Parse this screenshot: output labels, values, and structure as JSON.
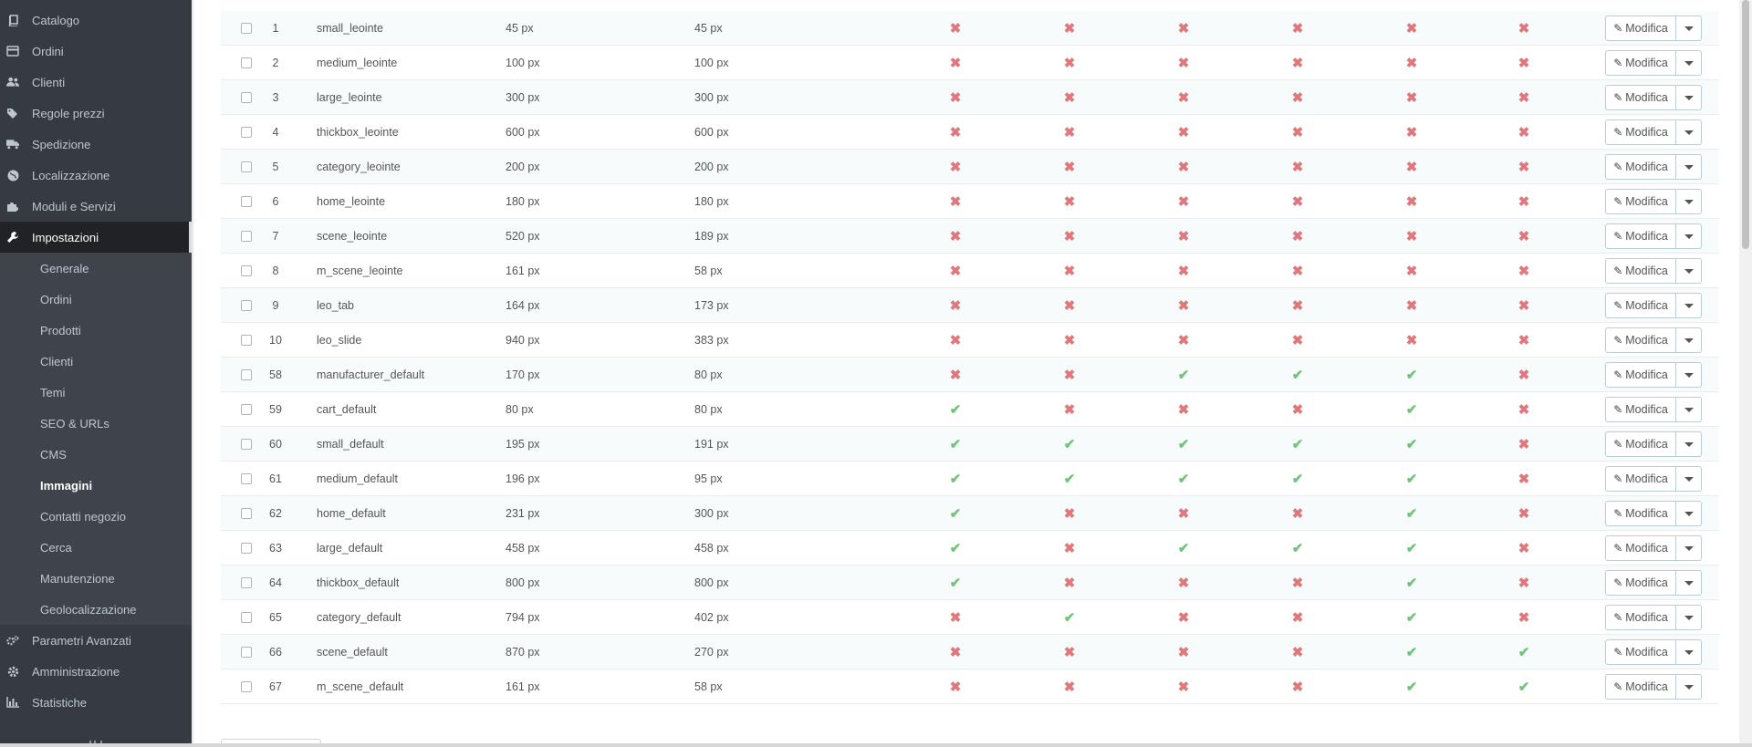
{
  "sidebar": {
    "items": [
      {
        "label": "Catalogo",
        "icon": "book-icon"
      },
      {
        "label": "Ordini",
        "icon": "credit-card-icon"
      },
      {
        "label": "Clienti",
        "icon": "users-icon"
      },
      {
        "label": "Regole prezzi",
        "icon": "tags-icon"
      },
      {
        "label": "Spedizione",
        "icon": "truck-icon"
      },
      {
        "label": "Localizzazione",
        "icon": "globe-icon"
      },
      {
        "label": "Moduli e Servizi",
        "icon": "puzzle-icon"
      },
      {
        "label": "Impostazioni",
        "icon": "wrench-icon"
      },
      {
        "label": "Parametri Avanzati",
        "icon": "cogs-icon"
      },
      {
        "label": "Amministrazione",
        "icon": "cog-icon"
      },
      {
        "label": "Statistiche",
        "icon": "bar-chart-icon"
      }
    ],
    "submenu": [
      "Generale",
      "Ordini",
      "Prodotti",
      "Clienti",
      "Temi",
      "SEO & URLs",
      "CMS",
      "Immagini",
      "Contatti negozio",
      "Cerca",
      "Manutenzione",
      "Geolocalizzazione"
    ]
  },
  "table": {
    "edit_label": "Modifica",
    "rows": [
      {
        "id": "1",
        "name": "small_leointe",
        "width": "45 px",
        "height": "45 px",
        "flags": [
          0,
          0,
          0,
          0,
          0,
          0
        ]
      },
      {
        "id": "2",
        "name": "medium_leointe",
        "width": "100 px",
        "height": "100 px",
        "flags": [
          0,
          0,
          0,
          0,
          0,
          0
        ]
      },
      {
        "id": "3",
        "name": "large_leointe",
        "width": "300 px",
        "height": "300 px",
        "flags": [
          0,
          0,
          0,
          0,
          0,
          0
        ]
      },
      {
        "id": "4",
        "name": "thickbox_leointe",
        "width": "600 px",
        "height": "600 px",
        "flags": [
          0,
          0,
          0,
          0,
          0,
          0
        ]
      },
      {
        "id": "5",
        "name": "category_leointe",
        "width": "200 px",
        "height": "200 px",
        "flags": [
          0,
          0,
          0,
          0,
          0,
          0
        ]
      },
      {
        "id": "6",
        "name": "home_leointe",
        "width": "180 px",
        "height": "180 px",
        "flags": [
          0,
          0,
          0,
          0,
          0,
          0
        ]
      },
      {
        "id": "7",
        "name": "scene_leointe",
        "width": "520 px",
        "height": "189 px",
        "flags": [
          0,
          0,
          0,
          0,
          0,
          0
        ]
      },
      {
        "id": "8",
        "name": "m_scene_leointe",
        "width": "161 px",
        "height": "58 px",
        "flags": [
          0,
          0,
          0,
          0,
          0,
          0
        ]
      },
      {
        "id": "9",
        "name": "leo_tab",
        "width": "164 px",
        "height": "173 px",
        "flags": [
          0,
          0,
          0,
          0,
          0,
          0
        ]
      },
      {
        "id": "10",
        "name": "leo_slide",
        "width": "940 px",
        "height": "383 px",
        "flags": [
          0,
          0,
          0,
          0,
          0,
          0
        ]
      },
      {
        "id": "58",
        "name": "manufacturer_default",
        "width": "170 px",
        "height": "80 px",
        "flags": [
          0,
          0,
          1,
          1,
          1,
          0
        ]
      },
      {
        "id": "59",
        "name": "cart_default",
        "width": "80 px",
        "height": "80 px",
        "flags": [
          1,
          0,
          0,
          0,
          1,
          0
        ]
      },
      {
        "id": "60",
        "name": "small_default",
        "width": "195 px",
        "height": "191 px",
        "flags": [
          1,
          1,
          1,
          1,
          1,
          0
        ]
      },
      {
        "id": "61",
        "name": "medium_default",
        "width": "196 px",
        "height": "95 px",
        "flags": [
          1,
          1,
          1,
          1,
          1,
          0
        ]
      },
      {
        "id": "62",
        "name": "home_default",
        "width": "231 px",
        "height": "300 px",
        "flags": [
          1,
          0,
          0,
          0,
          1,
          0
        ]
      },
      {
        "id": "63",
        "name": "large_default",
        "width": "458 px",
        "height": "458 px",
        "flags": [
          1,
          0,
          1,
          1,
          1,
          0
        ]
      },
      {
        "id": "64",
        "name": "thickbox_default",
        "width": "800 px",
        "height": "800 px",
        "flags": [
          1,
          0,
          0,
          0,
          1,
          0
        ]
      },
      {
        "id": "65",
        "name": "category_default",
        "width": "794 px",
        "height": "402 px",
        "flags": [
          0,
          1,
          0,
          0,
          1,
          0
        ]
      },
      {
        "id": "66",
        "name": "scene_default",
        "width": "870 px",
        "height": "270 px",
        "flags": [
          0,
          0,
          0,
          0,
          1,
          1
        ]
      },
      {
        "id": "67",
        "name": "m_scene_default",
        "width": "161 px",
        "height": "58 px",
        "flags": [
          0,
          0,
          0,
          0,
          1,
          1
        ]
      }
    ]
  },
  "colors": {
    "sidebar_bg": "#363a41",
    "submenu_bg": "#3f444c",
    "yes": "#72c279",
    "no": "#e0787b"
  }
}
